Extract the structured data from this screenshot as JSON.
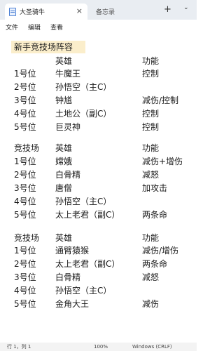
{
  "tabs": [
    {
      "title": "大圣骑牛",
      "active": true
    },
    {
      "title": "备忘录",
      "active": false
    }
  ],
  "tab_controls": {
    "close": "×",
    "new_tab": "+",
    "more": "⌄"
  },
  "menu": [
    "文件",
    "编辑",
    "查看"
  ],
  "document": {
    "heading": "新手竞技场阵容",
    "sections": [
      {
        "header": [
          "",
          "英雄",
          "功能"
        ],
        "rows": [
          [
            "1号位",
            "牛魔王",
            "控制"
          ],
          [
            "2号位",
            "孙悟空（主C）",
            ""
          ],
          [
            "3号位",
            "钟馗",
            "减伤/控制"
          ],
          [
            "4号位",
            "土地公（副C）",
            "控制"
          ],
          [
            "5号位",
            "巨灵神",
            "控制"
          ]
        ]
      },
      {
        "header": [
          "竞技场",
          "英雄",
          "功能"
        ],
        "rows": [
          [
            "1号位",
            "嫦娥",
            "减伤+增伤"
          ],
          [
            "2号位",
            "白骨精",
            "减怒"
          ],
          [
            "3号位",
            "唐僧",
            "加攻击"
          ],
          [
            "4号位",
            "孙悟空（主C）",
            ""
          ],
          [
            "5号位",
            "太上老君（副C）",
            "两条命"
          ]
        ]
      },
      {
        "header": [
          "竞技场",
          "英雄",
          "功能"
        ],
        "rows": [
          [
            "1号位",
            "通臂猿猴",
            "减伤/增伤"
          ],
          [
            "2号位",
            "太上老君（副C）",
            "两条命"
          ],
          [
            "3号位",
            "白骨精",
            "减怒"
          ],
          [
            "4号位",
            "孙悟空（主C）",
            ""
          ],
          [
            "5号位",
            "金角大王",
            "减伤"
          ]
        ]
      }
    ]
  },
  "status": {
    "position": "行 1，列 1",
    "zoom": "100%",
    "line_ending": "Windows (CRLF)"
  },
  "colors": {
    "heading_highlight": "#fbeecb",
    "titlebar": "#e9edf2"
  }
}
